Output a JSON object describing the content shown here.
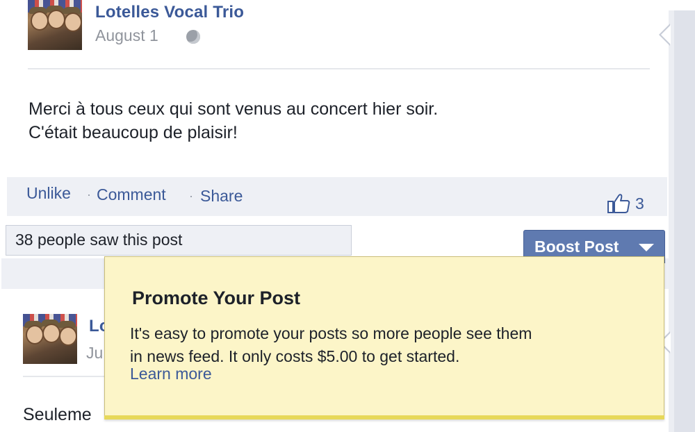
{
  "post1": {
    "author": "Lotelles Vocal Trio",
    "date": "August 1",
    "text_line1": "Merci à tous ceux qui sont venus au concert hier soir.",
    "text_line2": "C'était beaucoup de plaisir!",
    "actions": {
      "unlike": "Unlike",
      "comment": "Comment",
      "share": "Share",
      "separator": "·"
    },
    "like_count": "3",
    "seen_text": "38 people saw this post",
    "boost_label": "Boost Post"
  },
  "post2": {
    "author_partial": "Lo",
    "date_partial": "Ju",
    "text_partial": "Seuleme"
  },
  "promote_popup": {
    "title": "Promote Your Post",
    "body_line1": "It's easy to promote your posts so more people see them",
    "body_line2": "in news feed. It only costs $5.00 to get started.",
    "link": "Learn more"
  },
  "colors": {
    "link_blue": "#3b5998",
    "boost_button": "#5f7ab0",
    "popup_bg": "#fcf5c8",
    "action_bar_bg": "#eef0f5"
  },
  "icons": [
    "globe-icon",
    "thumbs-up-icon",
    "chevron-down-icon"
  ]
}
